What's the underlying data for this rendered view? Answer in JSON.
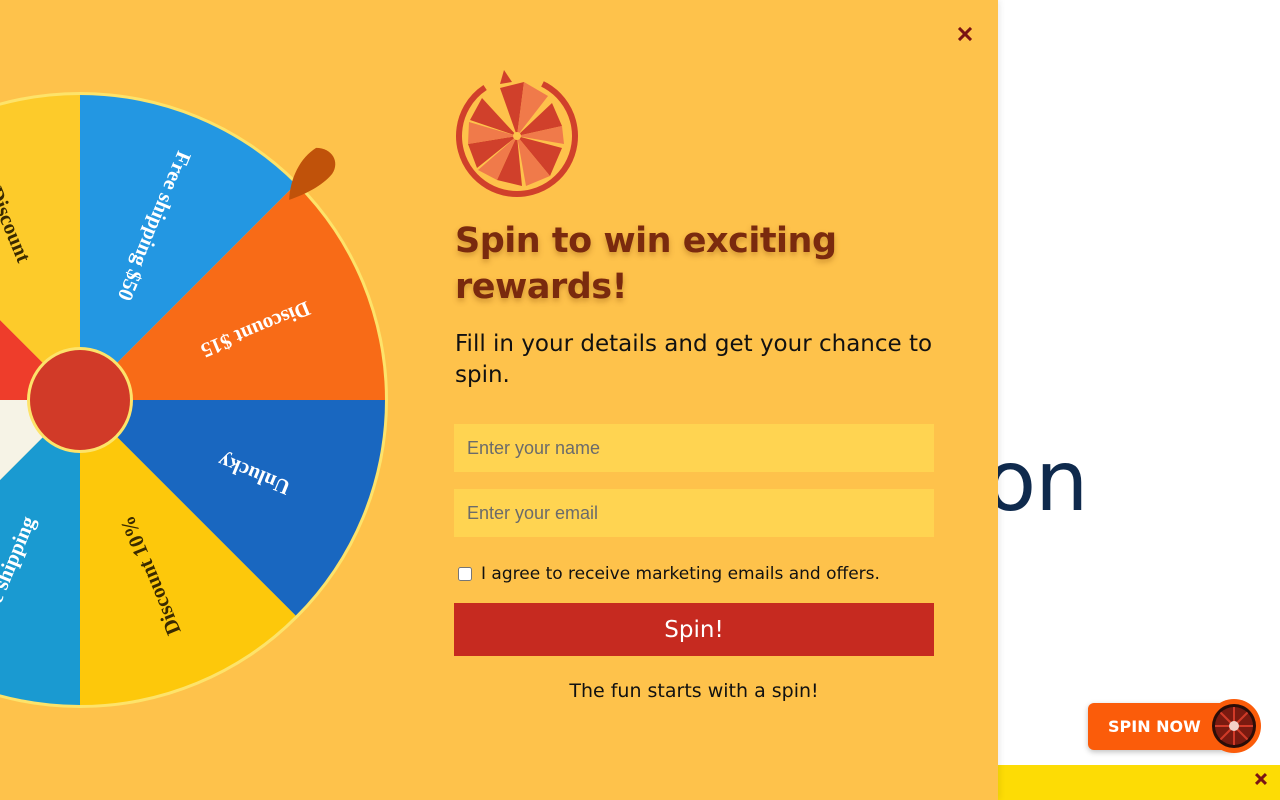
{
  "background": {
    "heading_fragment": "ation",
    "spin_now_label": "SPIN NOW"
  },
  "modal": {
    "title": "Spin to win exciting rewards!",
    "subtitle": "Fill in your details and get your chance to spin.",
    "name_placeholder": "Enter your name",
    "email_placeholder": "Enter your email",
    "consent_label": "I agree to receive marketing emails and offers.",
    "spin_button": "Spin!",
    "tagline": "The fun starts with a spin!"
  },
  "wheel": {
    "segments": [
      {
        "label": "Free shipping $50",
        "color": "#2397e2"
      },
      {
        "label": "Discount $15",
        "color": "#f86b17"
      },
      {
        "label": "Unlucky",
        "color": "#1967c0"
      },
      {
        "label": "Discount 10%",
        "color": "#fdc80b"
      },
      {
        "label": "Free shipping",
        "color": "#1a9ad1"
      },
      {
        "label": "",
        "color": "#f6f3e6"
      },
      {
        "label": "",
        "color": "#ee3d2b"
      },
      {
        "label": "Discount",
        "color": "#fdcb2a"
      }
    ],
    "rim_color": "#fde36a",
    "hub_color": "#d13a28",
    "pointer_color": "#c0520a"
  },
  "icons": {
    "close": "close-icon",
    "logo": "prize-wheel-icon",
    "mini_wheel": "mini-wheel-icon"
  },
  "colors": {
    "modal_bg": "#fec24b",
    "title": "#7a2a0e",
    "button": "#c62a20",
    "spin_now": "#fb5c0a",
    "bottom_bar": "#fddc05"
  }
}
